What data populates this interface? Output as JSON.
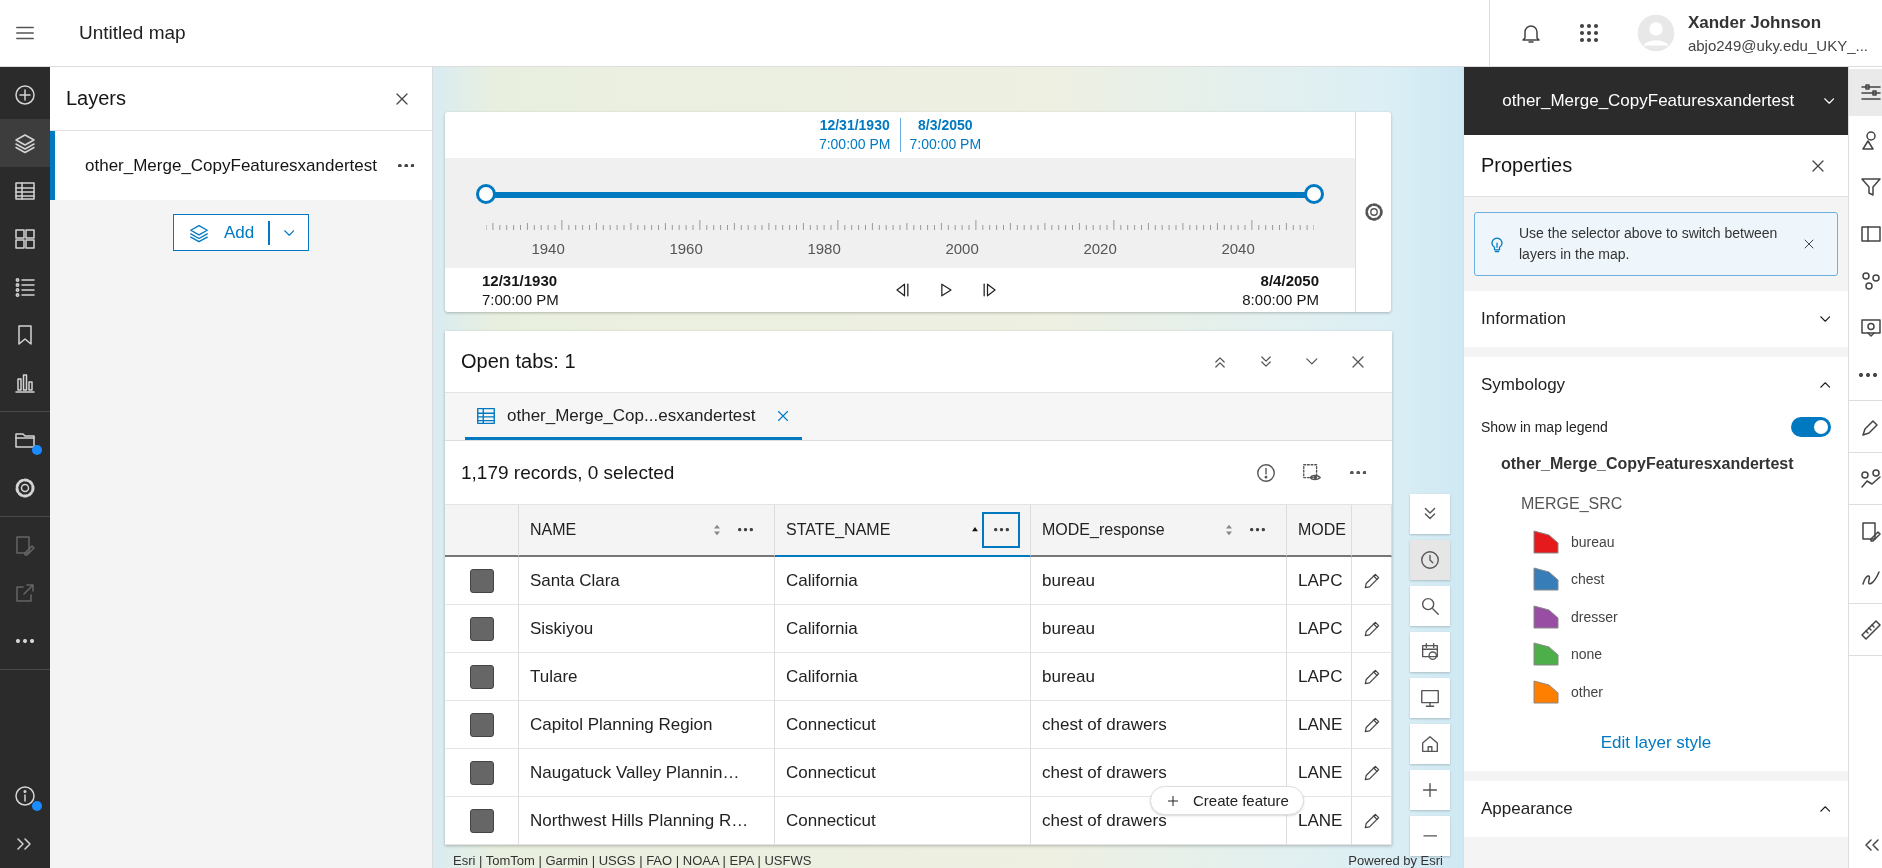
{
  "header": {
    "title": "Untitled map",
    "user_name": "Xander Johnson",
    "user_email": "abjo249@uky.edu_UKY_..."
  },
  "nav_rail": {
    "groups": [
      [
        {
          "kind": "add",
          "selected": false,
          "badge": false,
          "disabled": false
        },
        {
          "kind": "layers",
          "selected": true,
          "badge": false,
          "disabled": false
        },
        {
          "kind": "table",
          "selected": false,
          "badge": false,
          "disabled": false
        },
        {
          "kind": "basemap",
          "selected": false,
          "badge": false,
          "disabled": false
        },
        {
          "kind": "legend",
          "selected": false,
          "badge": false,
          "disabled": false
        },
        {
          "kind": "bookmark",
          "selected": false,
          "badge": false,
          "disabled": false
        },
        {
          "kind": "chart",
          "selected": false,
          "badge": false,
          "disabled": false
        }
      ],
      [
        {
          "kind": "folder",
          "selected": false,
          "badge": true,
          "disabled": false
        },
        {
          "kind": "gear",
          "selected": false,
          "badge": false,
          "disabled": false
        }
      ],
      [
        {
          "kind": "sketch",
          "selected": false,
          "badge": false,
          "disabled": true
        },
        {
          "kind": "share",
          "selected": false,
          "badge": false,
          "disabled": true
        },
        {
          "kind": "more",
          "selected": false,
          "badge": false,
          "disabled": false
        }
      ]
    ],
    "bottom": [
      {
        "kind": "info",
        "selected": false,
        "badge": true,
        "disabled": false
      },
      {
        "kind": "expand",
        "selected": false,
        "badge": false,
        "disabled": false
      }
    ]
  },
  "layers_panel": {
    "title": "Layers",
    "layers": [
      {
        "name": "other_Merge_CopyFeaturesxandertest",
        "selected": true
      }
    ],
    "add_button": "Add"
  },
  "time_slider": {
    "range_start": {
      "date": "12/31/1930",
      "time": "7:00:00 PM"
    },
    "range_end": {
      "date": "8/3/2050",
      "time": "7:00:00 PM"
    },
    "thumbs": [
      {
        "level": 0
      },
      {
        "level": 1
      }
    ],
    "tick_labels": [
      "1940",
      "1960",
      "1980",
      "2000",
      "2020",
      "2040"
    ],
    "full_start": {
      "date": "12/31/1930",
      "time": "7:00:00 PM"
    },
    "full_end": {
      "date": "8/4/2050",
      "time": "8:00:00 PM"
    }
  },
  "table_panel": {
    "title": "Open tabs: 1",
    "tabs": [
      {
        "label": "other_Merge_Cop...esxandertest",
        "selected": true
      }
    ],
    "summary": "1,179 records, 0 selected",
    "columns": [
      {
        "kind": "full",
        "label": "NAME",
        "sorted": false,
        "focused": false
      },
      {
        "kind": "full",
        "label": "STATE_NAME",
        "sorted": true,
        "focused": true
      },
      {
        "kind": "full",
        "label": "MODE_response",
        "sorted": false,
        "focused": false
      },
      {
        "kind": "partial",
        "label": "MODE"
      }
    ],
    "rows": [
      {
        "selected": false,
        "cells": [
          "Santa Clara",
          "California",
          "bureau",
          "LAPC"
        ]
      },
      {
        "selected": false,
        "cells": [
          "Siskiyou",
          "California",
          "bureau",
          "LAPC"
        ]
      },
      {
        "selected": false,
        "cells": [
          "Tulare",
          "California",
          "bureau",
          "LAPC"
        ]
      },
      {
        "selected": false,
        "cells": [
          "Capitol Planning Region",
          "Connecticut",
          "chest of drawers",
          "LANE"
        ]
      },
      {
        "selected": false,
        "cells": [
          "Naugatuck Valley Plannin…",
          "Connecticut",
          "chest of drawers",
          "LANE"
        ]
      },
      {
        "selected": false,
        "cells": [
          "Northwest Hills Planning R…",
          "Connecticut",
          "chest of drawers",
          "LANE"
        ]
      }
    ],
    "create_button": "Create feature"
  },
  "map_tools": [
    {
      "kind": "collapse",
      "selected": false
    },
    {
      "kind": "clock",
      "selected": true
    },
    {
      "kind": "search",
      "selected": false
    },
    {
      "kind": "print",
      "selected": false
    },
    {
      "kind": "monitor",
      "selected": false
    },
    {
      "kind": "home",
      "selected": false
    },
    {
      "kind": "zoom-in",
      "selected": false
    },
    {
      "kind": "zoom-out",
      "selected": false
    }
  ],
  "attribution": "Esri | TomTom | Garmin | USGS | FAO | NOAA | EPA | USFWS",
  "powered_by": "Powered by Esri",
  "properties_panel": {
    "layer_selector": "other_Merge_CopyFeaturesxandertest",
    "title": "Properties",
    "notice": "Use the selector above to switch between layers in the map.",
    "sections": [
      {
        "kind": "plain",
        "title": "Information",
        "expanded": false
      },
      {
        "kind": "symbology",
        "title": "Symbology",
        "expanded": true,
        "legend_toggle": {
          "label": "Show in map legend",
          "on": true
        },
        "layer_name": "other_Merge_CopyFeaturesxandertest",
        "field": "MERGE_SRC",
        "legend": [
          {
            "label": "bureau",
            "color": "#e41a1c"
          },
          {
            "label": "chest",
            "color": "#377eb8"
          },
          {
            "label": "dresser",
            "color": "#984ea3"
          },
          {
            "label": "none",
            "color": "#4daf4a"
          },
          {
            "label": "other",
            "color": "#ff7f00"
          }
        ],
        "edit_link": "Edit layer style"
      },
      {
        "kind": "plain",
        "title": "Appearance",
        "expanded": true
      }
    ]
  },
  "settings_rail": {
    "groups": [
      [
        {
          "kind": "properties",
          "selected": true
        },
        {
          "kind": "styles",
          "selected": false
        },
        {
          "kind": "filter",
          "selected": false
        },
        {
          "kind": "fields",
          "selected": false
        },
        {
          "kind": "cluster",
          "selected": false
        },
        {
          "kind": "popup",
          "selected": false
        },
        {
          "kind": "more",
          "selected": false
        }
      ],
      [
        {
          "kind": "edit",
          "selected": false
        }
      ],
      [
        {
          "kind": "analysis",
          "selected": false
        }
      ],
      [
        {
          "kind": "sketch",
          "selected": false
        },
        {
          "kind": "draw",
          "selected": false
        }
      ],
      [
        {
          "kind": "measure",
          "selected": false
        }
      ]
    ],
    "bottom": [
      {
        "kind": "collapse-left",
        "selected": false
      }
    ]
  }
}
